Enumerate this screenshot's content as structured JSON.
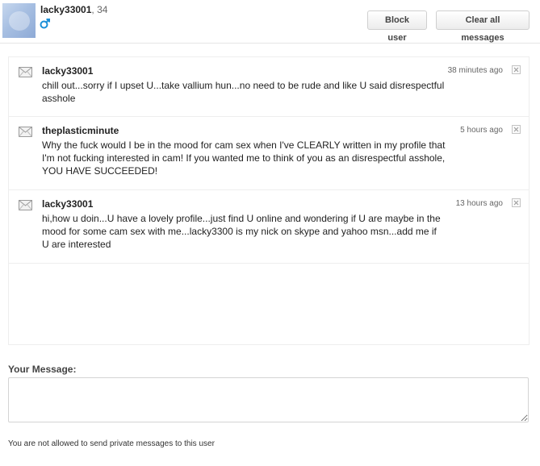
{
  "header": {
    "username": "lacky33001",
    "age": ", 34",
    "gender_icon": "male-symbol-icon",
    "block_label": "Block user",
    "clear_label": "Clear all messages"
  },
  "messages": [
    {
      "sender": "lacky33001",
      "time": "38 minutes ago",
      "body": "chill out...sorry if I upset U...take vallium hun...no need to be rude and like U said disrespectful asshole"
    },
    {
      "sender": "theplasticminute",
      "time": "5 hours ago",
      "body": "Why the fuck would I be in the mood for cam sex when I've CLEARLY written in my profile that I'm not fucking interested in cam! If you wanted me to think of you as an disrespectful asshole, YOU HAVE SUCCEEDED!"
    },
    {
      "sender": "lacky33001",
      "time": "13 hours ago",
      "body": "hi,how u doin...U have a lovely profile...just find U online and wondering if U are maybe in the mood for some cam sex with me...lacky3300 is my nick on skype and yahoo msn...add me if U are interested"
    }
  ],
  "compose": {
    "label": "Your Message:",
    "value": "",
    "notice": "You are not allowed to send private messages to this user"
  },
  "colors": {
    "accent_blue": "#1a8fd8",
    "border": "#eeeeee"
  }
}
